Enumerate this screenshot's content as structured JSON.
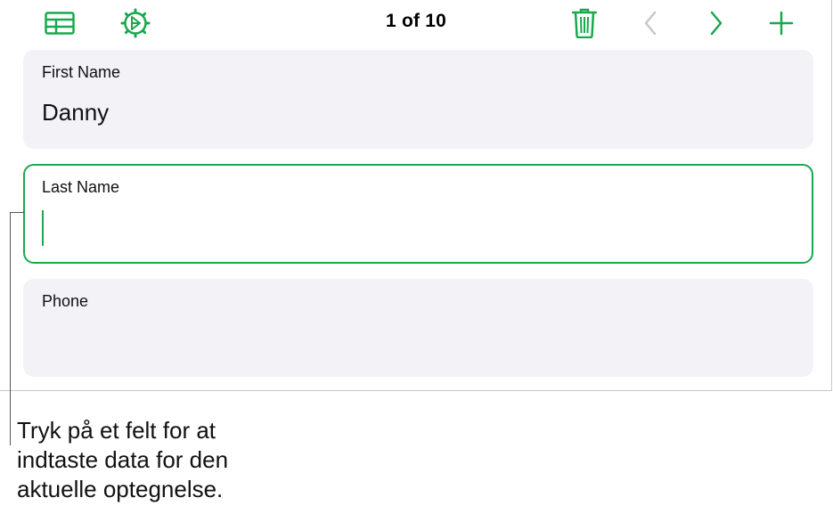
{
  "toolbar": {
    "icons": {
      "table": "table-icon",
      "settings": "gear-icon",
      "delete": "trash-icon",
      "previous": "chevron-left-icon",
      "next": "chevron-right-icon",
      "add": "plus-icon"
    },
    "record_counter": "1 of 10"
  },
  "fields": [
    {
      "label": "First Name",
      "value": "Danny"
    },
    {
      "label": "Last Name",
      "value": ""
    },
    {
      "label": "Phone",
      "value": ""
    }
  ],
  "callout": {
    "text": "Tryk på et felt for at indtaste data for den aktuelle optegnelse."
  },
  "colors": {
    "accent": "#1aa84f",
    "disabled_icon": "#c7c7cc",
    "card_background": "#f2f2f7"
  }
}
